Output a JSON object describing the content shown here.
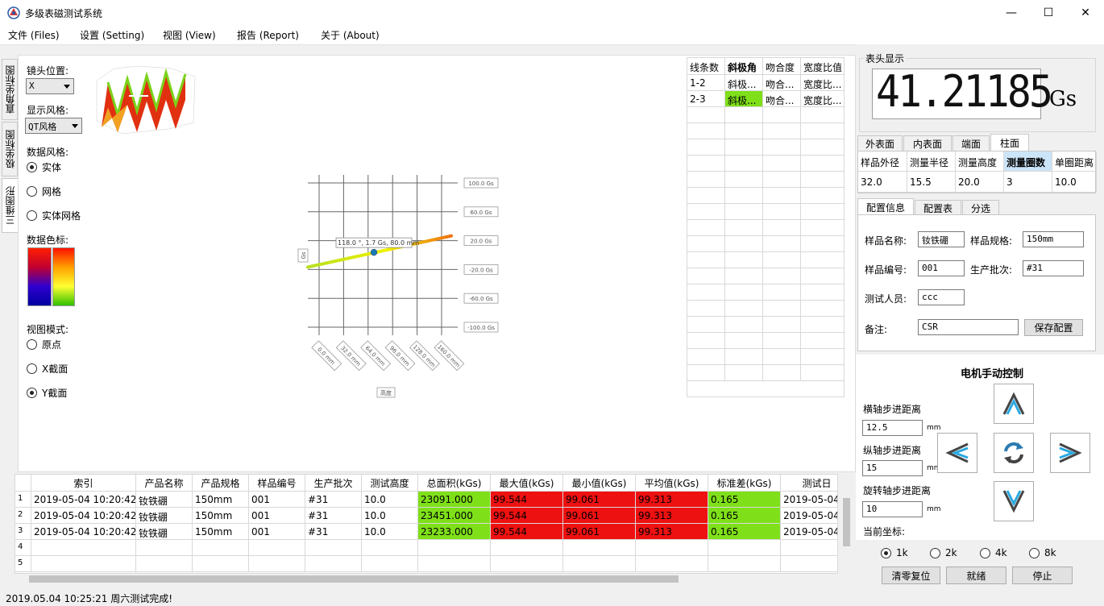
{
  "window": {
    "title": "多级表磁测试系统",
    "min": "—",
    "max": "☐",
    "close": "✕"
  },
  "menu": [
    "文件 (Files)",
    "设置 (Setting)",
    "视图 (View)",
    "报告 (Report)",
    "关于 (About)"
  ],
  "left_tabs": [
    "直角坐标图",
    "极坐标图",
    "三维图形"
  ],
  "controls": {
    "lens_label": "镜头位置:",
    "lens_value": "X",
    "style_label": "显示风格:",
    "style_value": "QT风格",
    "data_style_label": "数据风格:",
    "data_style_options": [
      "实体",
      "网格",
      "实体网格"
    ],
    "colorbar_label": "数据色标:",
    "view_mode_label": "视图模式:",
    "view_mode_options": [
      "原点",
      "X截面",
      "Y截面"
    ]
  },
  "chart_data": {
    "type": "line",
    "y_ticks": [
      "100.0 Gs",
      "60.0 Gs",
      "20.0 Gs",
      "-20.0 Gs",
      "-60.0 Gs",
      "-100.0 Gs"
    ],
    "x_ticks": [
      "0.0 mm",
      "32.0 mm",
      "64.0 mm",
      "96.0 mm",
      "128.0 mm",
      "160.0 mm"
    ],
    "ylabel": "Gs",
    "xlabel": "高度",
    "tooltip": "118.0 °, 1.7 Gs, 80.0 mm",
    "series": [
      {
        "x": [
          0,
          160
        ],
        "y": [
          -15,
          20
        ]
      }
    ],
    "marker": {
      "x": 80,
      "y": 1.7
    },
    "ylim": [
      -100,
      100
    ],
    "xlim": [
      0,
      160
    ]
  },
  "line_grid": {
    "headers": [
      "线条数",
      "斜极角",
      "吻合度",
      "宽度比值"
    ],
    "rows": [
      [
        "1-2",
        "斜极...",
        "吻合...",
        "宽度比..."
      ],
      [
        "2-3",
        "斜极...",
        "吻合...",
        "宽度比..."
      ]
    ]
  },
  "meter": {
    "label": "表头显示",
    "value": "41.21185",
    "unit": "Gs"
  },
  "sample_tabs": [
    "外表面",
    "内表面",
    "端面",
    "柱面"
  ],
  "sample_grid": {
    "headers": [
      "样品外径",
      "测量半径",
      "测量高度",
      "测量圈数",
      "单圈距离"
    ],
    "values": [
      "32.0",
      "15.5",
      "20.0",
      "3",
      "10.0"
    ]
  },
  "config_tabs": [
    "配置信息",
    "配置表",
    "分选"
  ],
  "config": {
    "name_label": "样品名称:",
    "name_value": "钕铁硼",
    "spec_label": "样品规格:",
    "spec_value": "150mm",
    "number_label": "样品编号:",
    "number_value": "001",
    "batch_label": "生产批次:",
    "batch_value": "#31",
    "tester_label": "测试人员:",
    "tester_value": "ccc",
    "note_label": "备注:",
    "note_value": "CSR",
    "save_button": "保存配置"
  },
  "motor": {
    "title": "电机手动控制",
    "h_label": "横轴步进距离",
    "h_value": "12.5",
    "unit": "mm",
    "v_label": "纵轴步进距离",
    "v_value": "15",
    "r_label": "旋转轴步进距离",
    "r_value": "10",
    "coord_label": "当前坐标:",
    "speed_options": [
      "1k",
      "2k",
      "4k",
      "8k"
    ],
    "reset_button": "清零复位",
    "ready_button": "就绪",
    "stop_button": "停止"
  },
  "results": {
    "headers": [
      "索引",
      "产品名称",
      "产品规格",
      "样品编号",
      "生产批次",
      "测试高度",
      "总面积(kGs)",
      "最大值(kGs)",
      "最小值(kGs)",
      "平均值(kGs)",
      "标准差(kGs)",
      "测试日"
    ],
    "row_numbers": [
      "1",
      "2",
      "3",
      "4",
      "5"
    ],
    "rows": [
      [
        "2019-05-04 10:20:42",
        "钕铁硼",
        "150mm",
        "001",
        "#31",
        "10.0",
        "23091.000",
        "99.544",
        "99.061",
        "99.313",
        "0.165",
        "2019-05-04"
      ],
      [
        "2019-05-04 10:20:42",
        "钕铁硼",
        "150mm",
        "001",
        "#31",
        "10.0",
        "23451.000",
        "99.544",
        "99.061",
        "99.313",
        "0.165",
        "2019-05-04"
      ],
      [
        "2019-05-04 10:20:42",
        "钕铁硼",
        "150mm",
        "001",
        "#31",
        "10.0",
        "23233.000",
        "99.544",
        "99.061",
        "99.313",
        "0.165",
        "2019-05-04"
      ]
    ]
  },
  "status": "2019.05.04 10:25:21 周六测试完成!"
}
